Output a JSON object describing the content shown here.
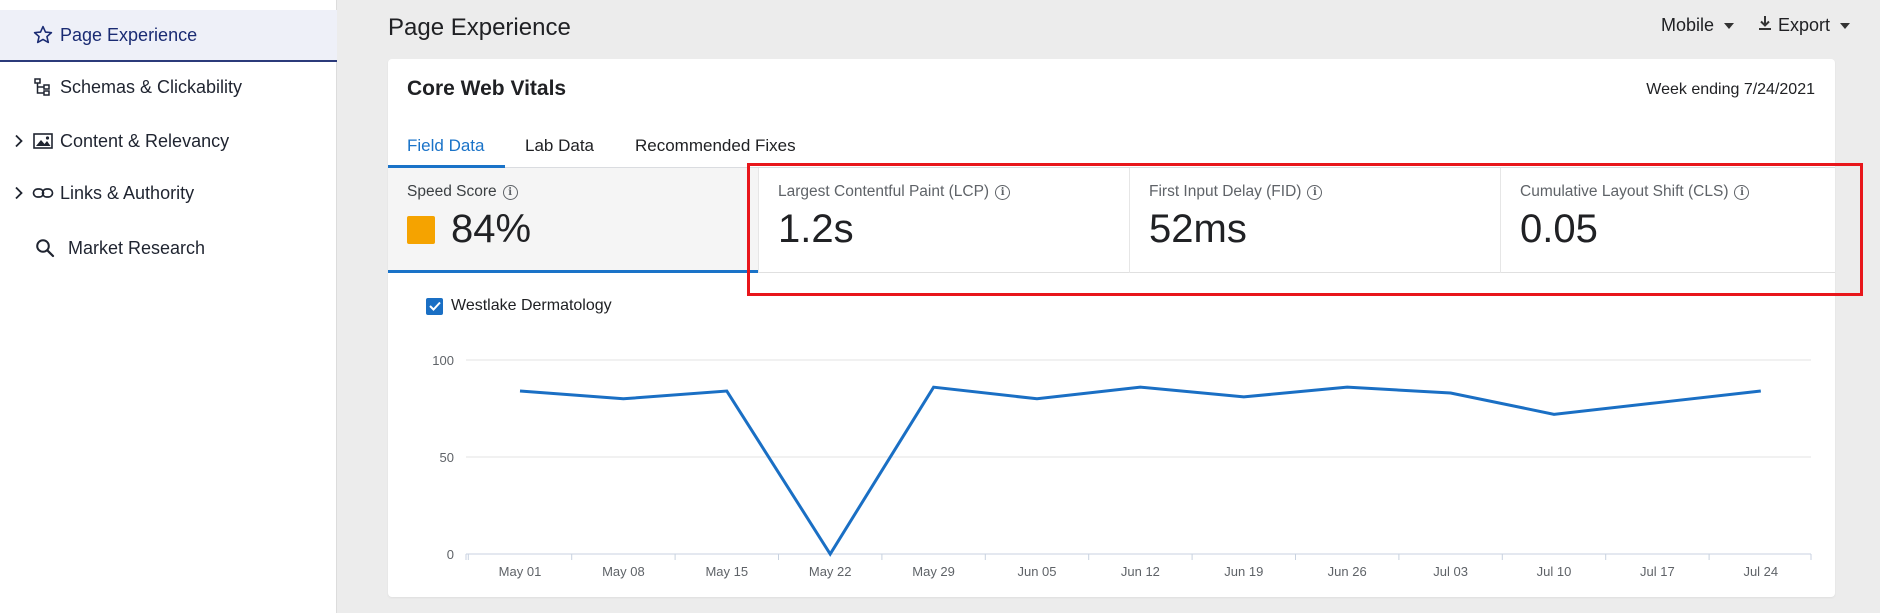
{
  "sidebar": {
    "items": [
      {
        "label": "Page Experience",
        "icon": "star-icon",
        "active": true,
        "expandable": false
      },
      {
        "label": "Schemas & Clickability",
        "icon": "hierarchy-icon",
        "active": false,
        "expandable": false
      },
      {
        "label": "Content & Relevancy",
        "icon": "image-icon",
        "active": false,
        "expandable": true
      },
      {
        "label": "Links & Authority",
        "icon": "link-icon",
        "active": false,
        "expandable": true
      },
      {
        "label": "Market Research",
        "icon": "search-icon",
        "active": false,
        "expandable": false
      }
    ]
  },
  "header": {
    "title": "Page Experience",
    "device": "Mobile",
    "export": "Export"
  },
  "card": {
    "title": "Core Web Vitals",
    "week": "Week ending 7/24/2021",
    "tabs": [
      "Field Data",
      "Lab Data",
      "Recommended Fixes"
    ],
    "metrics": [
      {
        "label": "Speed Score",
        "value": "84%",
        "swatch_color": "#f5a300"
      },
      {
        "label": "Largest Contentful Paint (LCP)",
        "value": "1.2s"
      },
      {
        "label": "First Input Delay (FID)",
        "value": "52ms"
      },
      {
        "label": "Cumulative Layout Shift (CLS)",
        "value": "0.05"
      }
    ],
    "legend": "Westlake Dermatology"
  },
  "colors": {
    "accent": "#1a73c8",
    "line": "#1a6fc4",
    "highlight": "#e8161b"
  },
  "chart_data": {
    "type": "line",
    "categories": [
      "May 01",
      "May 08",
      "May 15",
      "May 22",
      "May 29",
      "Jun 05",
      "Jun 12",
      "Jun 19",
      "Jun 26",
      "Jul 03",
      "Jul 10",
      "Jul 17",
      "Jul 24"
    ],
    "series": [
      {
        "name": "Westlake Dermatology",
        "values": [
          84,
          80,
          84,
          0,
          86,
          80,
          86,
          81,
          86,
          83,
          72,
          78,
          84
        ]
      }
    ],
    "yticks": [
      0,
      50,
      100
    ],
    "ylim": [
      0,
      100
    ],
    "grid": true
  }
}
